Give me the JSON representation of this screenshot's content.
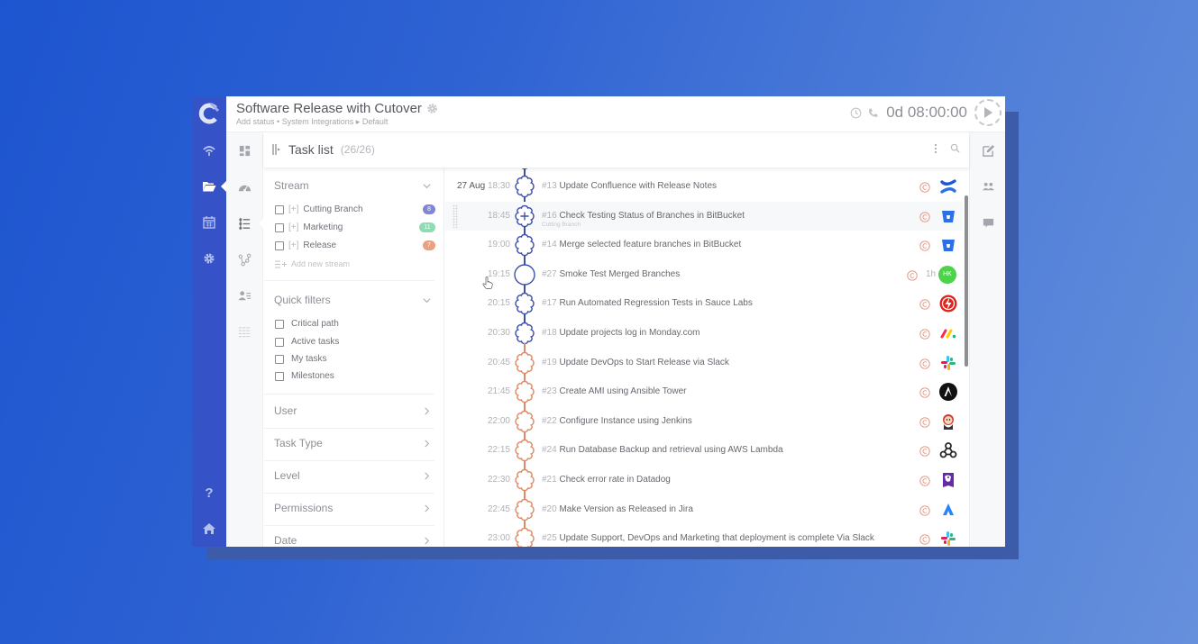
{
  "app": {
    "title": "Software Release with Cutover",
    "breadcrumb": {
      "status": "Add status",
      "separator1": "•",
      "workspace": "System Integrations",
      "separator2": "▸",
      "view": "Default"
    },
    "timer": "0d 08:00:00"
  },
  "left_rail": {
    "items": [
      {
        "name": "wifi-icon",
        "active": false
      },
      {
        "name": "folder-open-icon",
        "active": true
      },
      {
        "name": "calendar-icon",
        "active": false
      },
      {
        "name": "settings-icon",
        "active": false
      },
      {
        "name": "help-icon",
        "active": false
      },
      {
        "name": "home-icon",
        "active": false
      }
    ]
  },
  "view_rail": {
    "items": [
      {
        "name": "dashboard-icon",
        "active": false
      },
      {
        "name": "gauge-icon",
        "active": false
      },
      {
        "name": "task-list-icon",
        "active": true
      },
      {
        "name": "node-map-icon",
        "active": false
      },
      {
        "name": "team-icon",
        "active": false
      },
      {
        "name": "table-grid-icon",
        "active": false
      }
    ]
  },
  "task_list": {
    "title": "Task list",
    "count": "(26/26)"
  },
  "filters": {
    "stream": {
      "title": "Stream",
      "items": [
        {
          "bracket": "[+]",
          "label": "Cutting Branch",
          "count": "8",
          "color": "#7f86d2"
        },
        {
          "bracket": "[+]",
          "label": "Marketing",
          "count": "11",
          "color": "#8fdcb4"
        },
        {
          "bracket": "[+]",
          "label": "Release",
          "count": "7",
          "color": "#e9a17f"
        }
      ],
      "add_label": "Add new stream"
    },
    "quick_filters": {
      "title": "Quick filters",
      "items": [
        "Critical path",
        "Active tasks",
        "My tasks",
        "Milestones"
      ]
    },
    "collapsed_sections": [
      "User",
      "Task Type",
      "Level",
      "Permissions",
      "Date"
    ]
  },
  "stream_colors": {
    "cutting_branch": "#3d4fa8",
    "release": "#de8a66"
  },
  "tasks": [
    {
      "date": "27 Aug",
      "time": "18:30",
      "num": "#13",
      "title": "Update Confluence with Release Notes",
      "shape": "gear",
      "stream": "blue",
      "integration": "confluence-icon"
    },
    {
      "date": "",
      "time": "18:45",
      "num": "#16",
      "title": "Check Testing Status of Branches in BitBucket",
      "sub": "Cutting Branch",
      "shape": "gear-plus",
      "stream": "blue",
      "integration": "bitbucket-icon",
      "highlighted": true
    },
    {
      "date": "",
      "time": "19:00",
      "num": "#14",
      "title": "Merge selected feature branches in BitBucket",
      "shape": "gear",
      "stream": "blue",
      "integration": "bitbucket-icon"
    },
    {
      "date": "",
      "time": "19:15",
      "num": "#27",
      "title": "Smoke Test Merged Branches",
      "shape": "circle",
      "stream": "blue",
      "duration": "1h",
      "assignee": "HK",
      "assignee_color": "#4cd34a"
    },
    {
      "date": "",
      "time": "20:15",
      "num": "#17",
      "title": "Run Automated Regression Tests in Sauce Labs",
      "shape": "gear",
      "stream": "blue",
      "integration": "saucelabs-icon"
    },
    {
      "date": "",
      "time": "20:30",
      "num": "#18",
      "title": "Update projects log in Monday.com",
      "shape": "gear",
      "stream": "blue",
      "integration": "monday-icon"
    },
    {
      "date": "",
      "time": "20:45",
      "num": "#19",
      "title": "Update DevOps to Start Release via Slack",
      "shape": "gear",
      "stream": "orange",
      "integration": "slack-icon"
    },
    {
      "date": "",
      "time": "21:45",
      "num": "#23",
      "title": "Create AMI using Ansible Tower",
      "shape": "gear",
      "stream": "orange",
      "integration": "ansible-icon"
    },
    {
      "date": "",
      "time": "22:00",
      "num": "#22",
      "title": "Configure Instance using Jenkins",
      "shape": "gear",
      "stream": "orange",
      "integration": "jenkins-icon"
    },
    {
      "date": "",
      "time": "22:15",
      "num": "#24",
      "title": "Run Database Backup and retrieval using AWS Lambda",
      "shape": "gear",
      "stream": "orange",
      "integration": "webhook-icon"
    },
    {
      "date": "",
      "time": "22:30",
      "num": "#21",
      "title": "Check error rate in Datadog",
      "shape": "gear",
      "stream": "orange",
      "integration": "datadog-icon"
    },
    {
      "date": "",
      "time": "22:45",
      "num": "#20",
      "title": "Make Version as Released in Jira",
      "shape": "gear",
      "stream": "orange",
      "integration": "jira-icon"
    },
    {
      "date": "",
      "time": "23:00",
      "num": "#25",
      "title": "Update Support, DevOps and Marketing that deployment is complete Via Slack",
      "shape": "gear",
      "stream": "orange",
      "integration": "slack-icon"
    }
  ]
}
